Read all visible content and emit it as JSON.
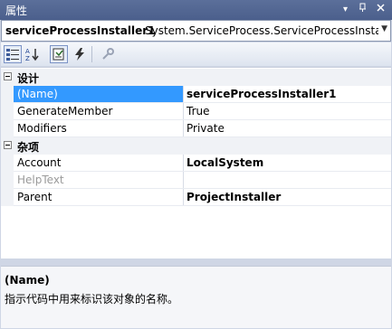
{
  "window": {
    "title": "属性",
    "buttons": {
      "dropdown": "▾",
      "pin": "📌",
      "close": "✕"
    }
  },
  "selector": {
    "object_name": "serviceProcessInstaller1",
    "object_type": "System.ServiceProcess.ServiceProcessInstalle",
    "arrow": "▾"
  },
  "toolbar": {
    "items": [
      {
        "name": "categorized-icon",
        "active": true
      },
      {
        "name": "alphabetical-icon",
        "active": false
      },
      {
        "name": "properties-icon",
        "active": true
      },
      {
        "name": "events-icon",
        "active": false
      },
      {
        "name": "property-pages-icon",
        "active": false
      }
    ]
  },
  "grid": {
    "categories": [
      {
        "label": "设计",
        "properties": [
          {
            "name": "(Name)",
            "value": "serviceProcessInstaller1",
            "bold": true,
            "selected": true
          },
          {
            "name": "GenerateMember",
            "value": "True"
          },
          {
            "name": "Modifiers",
            "value": "Private"
          }
        ]
      },
      {
        "label": "杂项",
        "properties": [
          {
            "name": "Account",
            "value": "LocalSystem",
            "bold": true
          },
          {
            "name": "HelpText",
            "value": "",
            "disabled": true
          },
          {
            "name": "Parent",
            "value": "ProjectInstaller",
            "bold": true
          }
        ]
      }
    ]
  },
  "description": {
    "title": "(Name)",
    "text": "指示代码中用来标识该对象的名称。"
  },
  "colors": {
    "selection": "#3399ff",
    "titlebar": "#4b5f8c",
    "window_bg": "#cfd6e5"
  }
}
